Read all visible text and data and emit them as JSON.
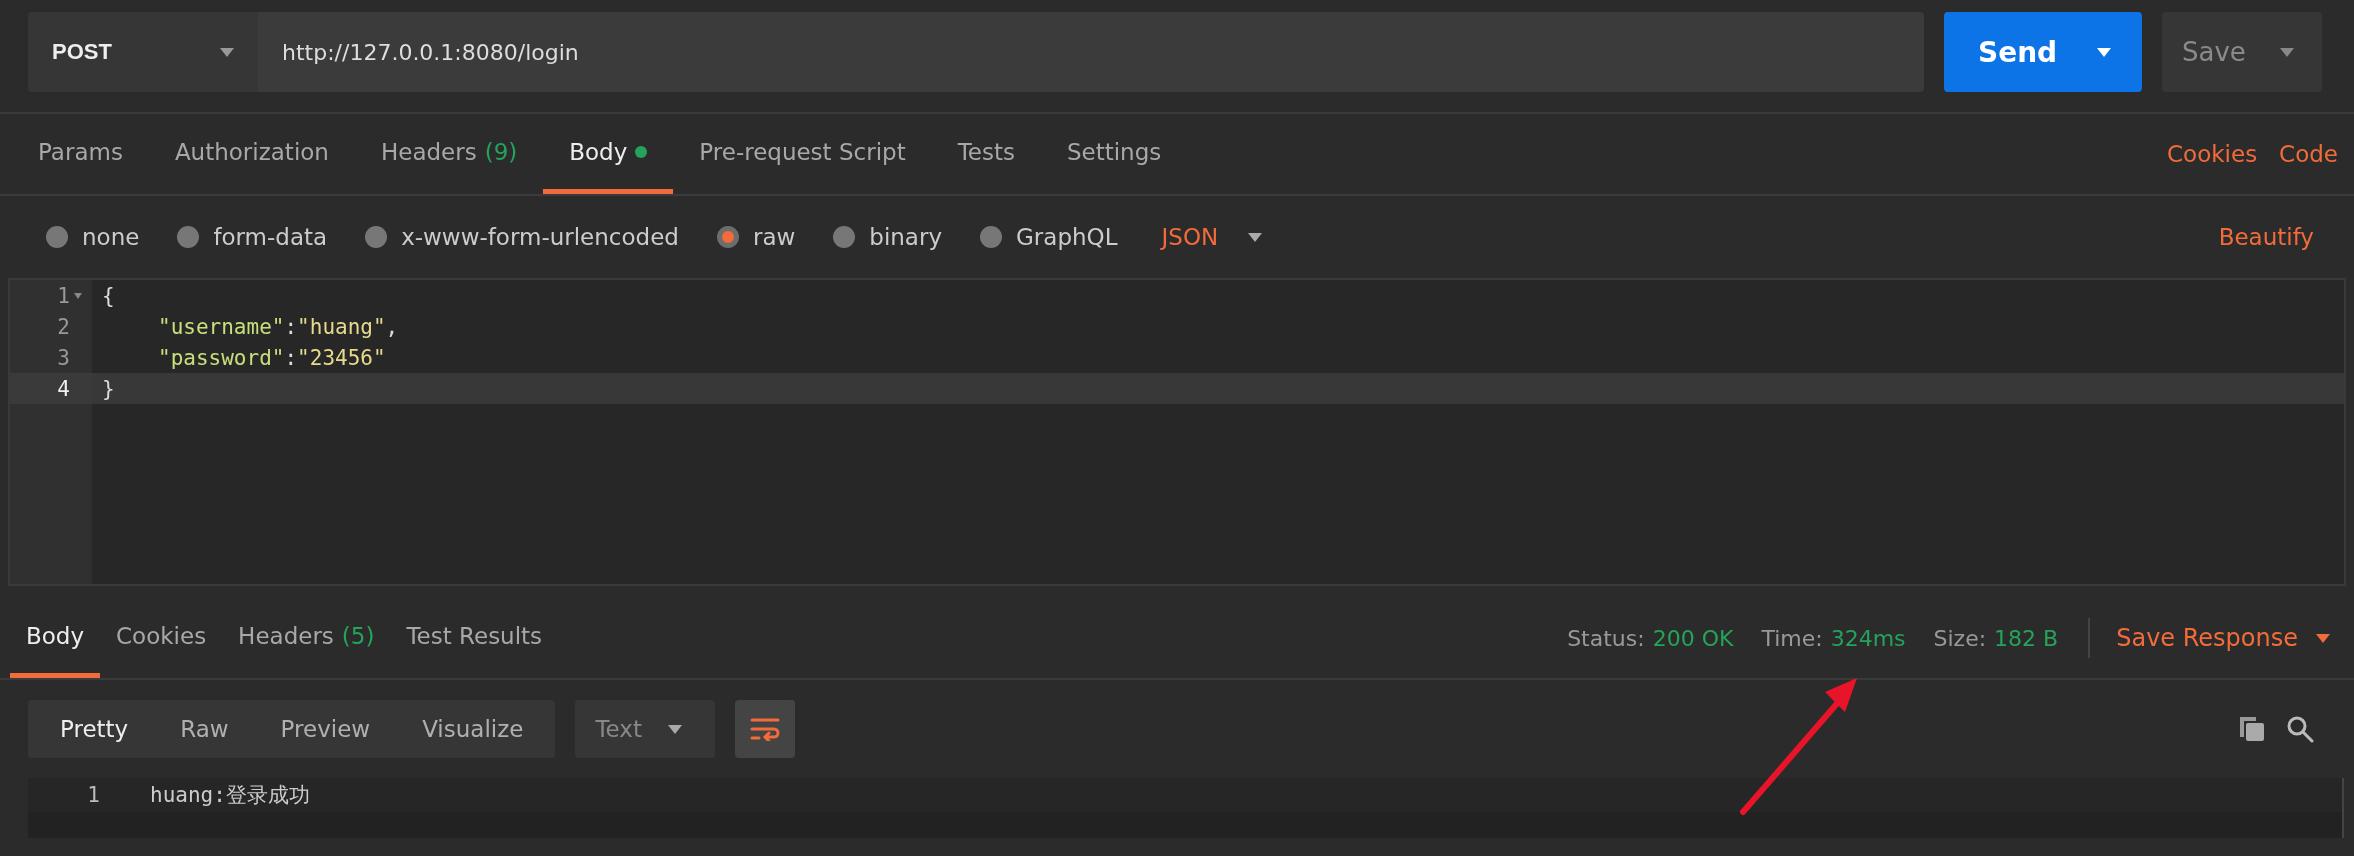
{
  "request": {
    "method": "POST",
    "url": "http://127.0.0.1:8080/login",
    "send_label": "Send",
    "save_label": "Save"
  },
  "request_tabs": [
    {
      "label": "Params",
      "selected": false
    },
    {
      "label": "Authorization",
      "selected": false
    },
    {
      "label": "Headers",
      "badge": "(9)",
      "selected": false
    },
    {
      "label": "Body",
      "dot": true,
      "selected": true
    },
    {
      "label": "Pre-request Script",
      "selected": false
    },
    {
      "label": "Tests",
      "selected": false
    },
    {
      "label": "Settings",
      "selected": false
    }
  ],
  "request_links": [
    "Cookies",
    "Code"
  ],
  "body_types": [
    {
      "label": "none",
      "selected": false
    },
    {
      "label": "form-data",
      "selected": false
    },
    {
      "label": "x-www-form-urlencoded",
      "selected": false
    },
    {
      "label": "raw",
      "selected": true
    },
    {
      "label": "binary",
      "selected": false
    },
    {
      "label": "GraphQL",
      "selected": false
    }
  ],
  "body_format": "JSON",
  "beautify": "Beautify",
  "editor_lines": [
    {
      "number": "1",
      "foldable": true,
      "indented": false,
      "active": false,
      "tokens": [
        {
          "kind": "punct",
          "text": "{"
        }
      ]
    },
    {
      "number": "2",
      "foldable": false,
      "indented": true,
      "active": false,
      "tokens": [
        {
          "kind": "key",
          "text": "\"username\""
        },
        {
          "kind": "punct",
          "text": ":"
        },
        {
          "kind": "string",
          "text": "\"huang\""
        },
        {
          "kind": "punct",
          "text": ","
        }
      ]
    },
    {
      "number": "3",
      "foldable": false,
      "indented": true,
      "active": false,
      "tokens": [
        {
          "kind": "key",
          "text": "\"password\""
        },
        {
          "kind": "punct",
          "text": ":"
        },
        {
          "kind": "string",
          "text": "\"23456\""
        }
      ]
    },
    {
      "number": "4",
      "foldable": false,
      "indented": false,
      "active": true,
      "tokens": [
        {
          "kind": "punct",
          "text": "}"
        }
      ]
    }
  ],
  "response_tabs": [
    {
      "label": "Body",
      "selected": true
    },
    {
      "label": "Cookies",
      "selected": false
    },
    {
      "label": "Headers",
      "badge": "(5)",
      "selected": false
    },
    {
      "label": "Test Results",
      "selected": false
    }
  ],
  "response_status": [
    {
      "label": "Status:",
      "value": "200 OK"
    },
    {
      "label": "Time:",
      "value": "324ms"
    },
    {
      "label": "Size:",
      "value": "182 B"
    }
  ],
  "save_response": "Save Response",
  "view_modes": [
    {
      "label": "Pretty",
      "selected": true
    },
    {
      "label": "Raw",
      "selected": false
    },
    {
      "label": "Preview",
      "selected": false
    },
    {
      "label": "Visualize",
      "selected": false
    }
  ],
  "response_format": "Text",
  "wrap_lines": true,
  "response_lines": [
    {
      "number": "1",
      "text": "huang:登录成功"
    }
  ]
}
